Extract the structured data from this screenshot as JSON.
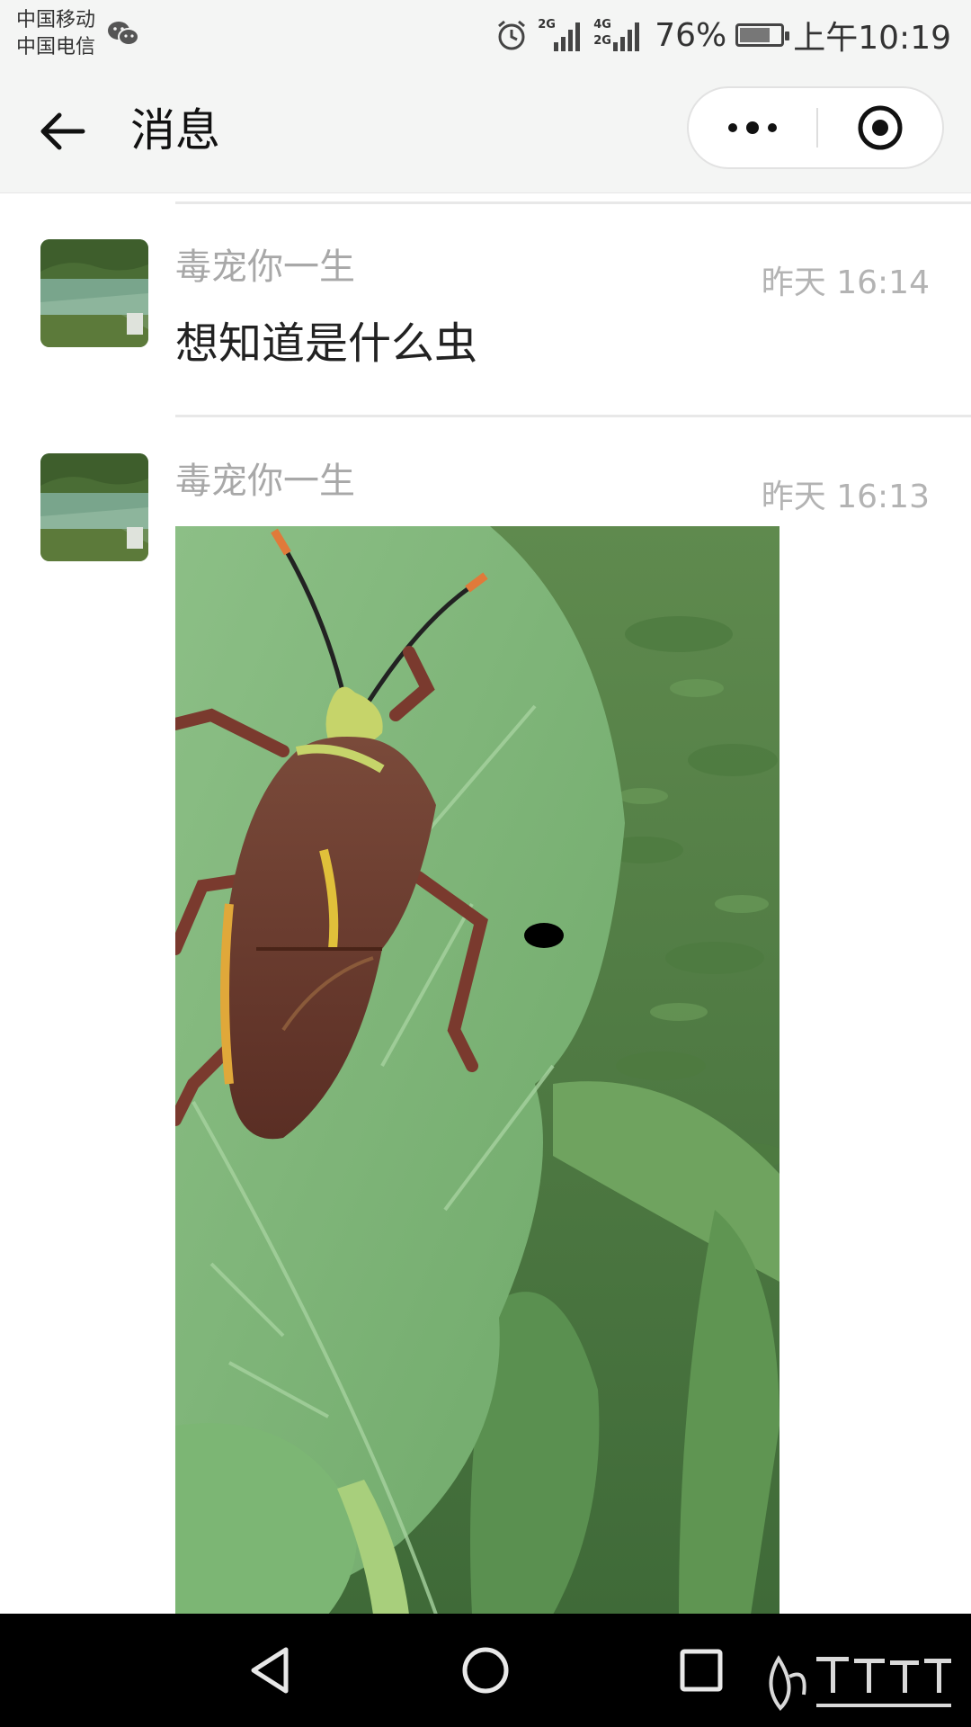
{
  "status_bar": {
    "carrier_1": "中国移动",
    "carrier_2": "中国电信",
    "signal_1_label": "2G",
    "signal_2_label_top": "4G",
    "signal_2_label_bottom": "2G",
    "battery": "76%",
    "battery_level": 0.76,
    "time": "上午10:19",
    "icons": [
      "wechat-icon",
      "alarm-icon",
      "signal-icon",
      "battery-icon"
    ]
  },
  "nav": {
    "title": "消息",
    "icons": [
      "back-arrow-icon",
      "more-icon",
      "close-target-icon"
    ]
  },
  "messages": [
    {
      "sender": "毒宠你一生",
      "time": "昨天 16:14",
      "text": "想知道是什么虫"
    },
    {
      "sender": "毒宠你一生",
      "time": "昨天 16:13",
      "image": "bug-on-leaf-photo"
    }
  ],
  "bottom_nav": {
    "icons": [
      "back-triangle-icon",
      "home-circle-icon",
      "recents-square-icon"
    ]
  },
  "colors": {
    "bar_bg": "#f4f5f4",
    "text_primary": "#222222",
    "text_secondary": "#a8a8a8",
    "divider": "#e8e8e8",
    "leaf_green": "#7fb07a",
    "bug_brown": "#6b3c2e"
  }
}
